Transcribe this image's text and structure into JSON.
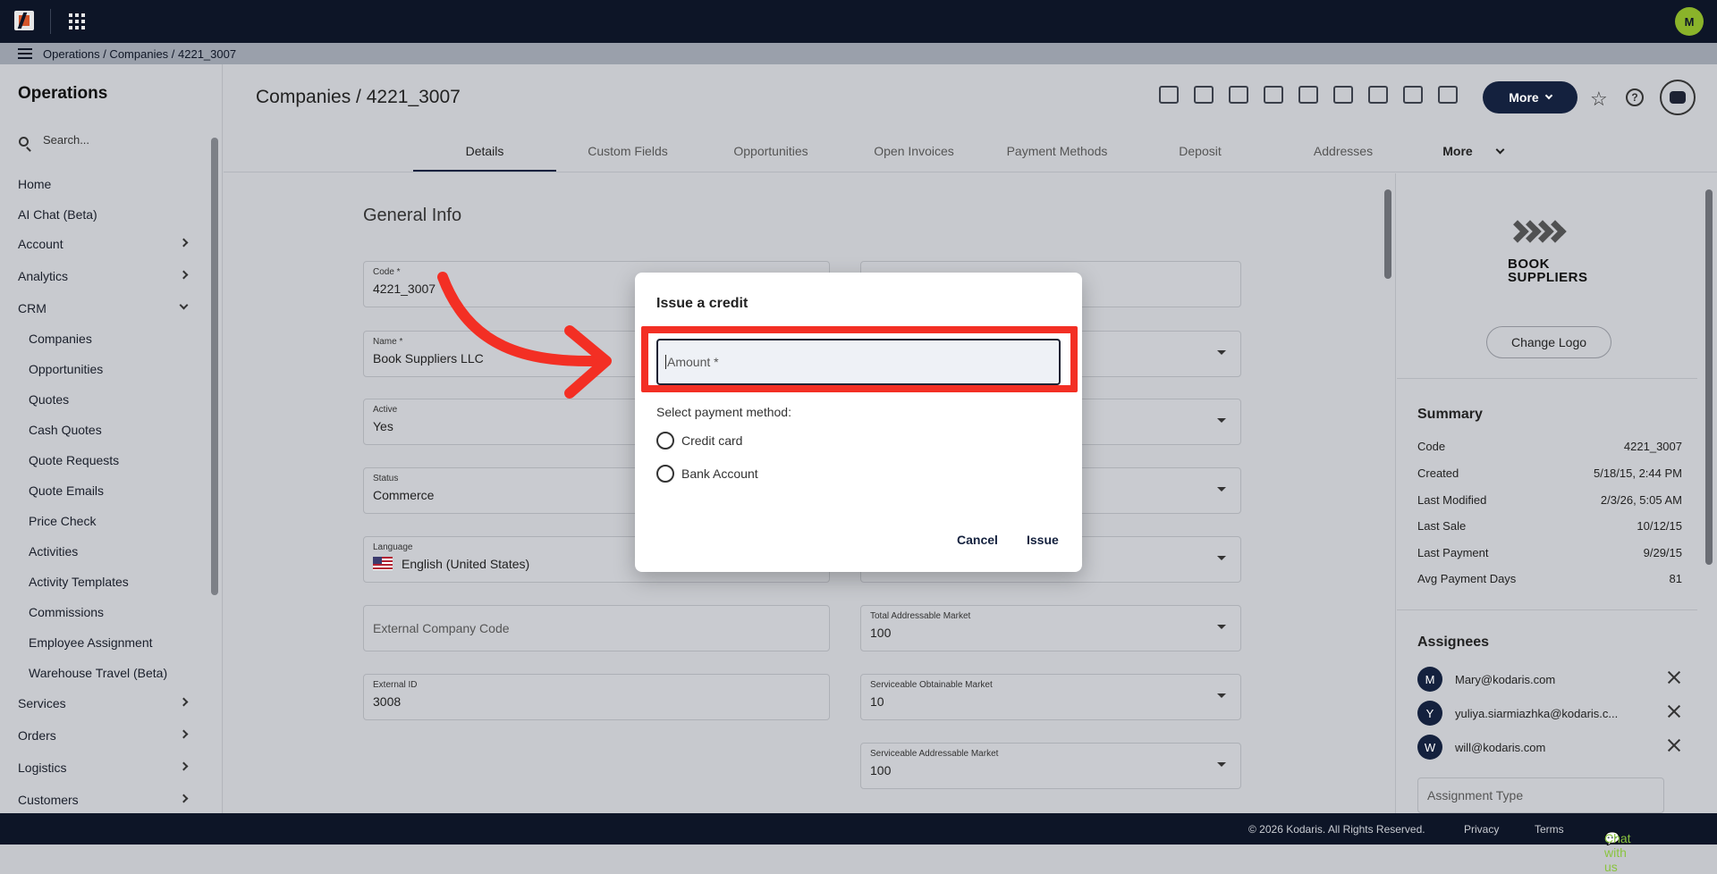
{
  "breadcrumb": {
    "text": "Operations / Companies / 4221_3007"
  },
  "user": {
    "initial": "M"
  },
  "sidebar": {
    "title": "Operations",
    "search_placeholder": "Search...",
    "items": [
      {
        "label": "Home"
      },
      {
        "label": "AI Chat (Beta)"
      },
      {
        "label": "Account"
      },
      {
        "label": "Analytics"
      },
      {
        "label": "CRM"
      },
      {
        "label": "Companies"
      },
      {
        "label": "Opportunities"
      },
      {
        "label": "Quotes"
      },
      {
        "label": "Cash Quotes"
      },
      {
        "label": "Quote Requests"
      },
      {
        "label": "Quote Emails"
      },
      {
        "label": "Price Check"
      },
      {
        "label": "Activities"
      },
      {
        "label": "Activity Templates"
      },
      {
        "label": "Commissions"
      },
      {
        "label": "Employee Assignment"
      },
      {
        "label": "Warehouse Travel (Beta)"
      },
      {
        "label": "Services"
      },
      {
        "label": "Orders"
      },
      {
        "label": "Logistics"
      },
      {
        "label": "Customers"
      }
    ]
  },
  "header": {
    "title": "Companies / 4221_3007",
    "more_label": "More",
    "help_label": "?"
  },
  "tabs": [
    {
      "label": "Details"
    },
    {
      "label": "Custom Fields"
    },
    {
      "label": "Opportunities"
    },
    {
      "label": "Open Invoices"
    },
    {
      "label": "Payment Methods"
    },
    {
      "label": "Deposit"
    },
    {
      "label": "Addresses"
    },
    {
      "label": "More"
    }
  ],
  "general_info": {
    "title": "General Info",
    "fields": {
      "code": {
        "label": "Code *",
        "value": "4221_3007"
      },
      "name": {
        "label": "Name *",
        "value": "Book Suppliers LLC"
      },
      "active": {
        "label": "Active",
        "value": "Yes"
      },
      "status": {
        "label": "Status",
        "value": "Commerce"
      },
      "language": {
        "label": "Language",
        "value": "English (United States)"
      },
      "external_company_code": {
        "placeholder": "External Company Code"
      },
      "external_id": {
        "label": "External ID",
        "value": "3008"
      },
      "tam": {
        "label": "Total Addressable Market",
        "value": "100"
      },
      "som": {
        "label": "Serviceable Obtainable Market",
        "value": "10"
      },
      "sam": {
        "label": "Serviceable Addressable Market",
        "value": "100"
      }
    }
  },
  "right_panel": {
    "logo_text_1": "BOOK",
    "logo_text_2": "SUPPLIERS",
    "change_logo": "Change Logo",
    "summary": {
      "title": "Summary",
      "rows": [
        {
          "k": "Code",
          "v": "4221_3007"
        },
        {
          "k": "Created",
          "v": "5/18/15, 2:44 PM"
        },
        {
          "k": "Last Modified",
          "v": "2/3/26, 5:05 AM"
        },
        {
          "k": "Last Sale",
          "v": "10/12/15"
        },
        {
          "k": "Last Payment",
          "v": "9/29/15"
        },
        {
          "k": "Avg Payment Days",
          "v": "81"
        }
      ]
    },
    "assignees": {
      "title": "Assignees",
      "rows": [
        {
          "initial": "M",
          "email": "Mary@kodaris.com"
        },
        {
          "initial": "Y",
          "email": "yuliya.siarmiazhka@kodaris.c..."
        },
        {
          "initial": "W",
          "email": "will@kodaris.com"
        }
      ],
      "type_placeholder": "Assignment Type"
    }
  },
  "modal": {
    "title": "Issue a credit",
    "amount_placeholder": "Amount *",
    "payment_label": "Select payment method:",
    "options": [
      {
        "label": "Credit card"
      },
      {
        "label": "Bank Account"
      }
    ],
    "cancel": "Cancel",
    "issue": "Issue"
  },
  "footer": {
    "copyright": "© 2026 Kodaris. All Rights Reserved.",
    "privacy": "Privacy",
    "terms": "Terms",
    "chat": "Chat with us"
  },
  "colors": {
    "annotation": "#f32f24",
    "brand": "#14213e",
    "accent": "#8ab32a"
  }
}
